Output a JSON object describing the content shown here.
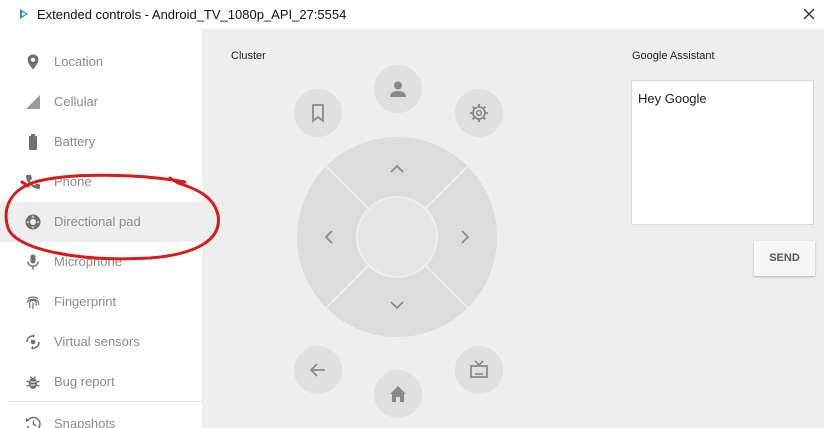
{
  "window": {
    "title": "Extended controls - Android_TV_1080p_API_27:5554"
  },
  "sidebar": {
    "items": [
      {
        "label": "Location",
        "icon": "location-pin-icon"
      },
      {
        "label": "Cellular",
        "icon": "signal-icon"
      },
      {
        "label": "Battery",
        "icon": "battery-icon"
      },
      {
        "label": "Phone",
        "icon": "phone-icon"
      },
      {
        "label": "Directional pad",
        "icon": "dpad-icon",
        "selected": true
      },
      {
        "label": "Microphone",
        "icon": "microphone-icon"
      },
      {
        "label": "Fingerprint",
        "icon": "fingerprint-icon"
      },
      {
        "label": "Virtual sensors",
        "icon": "rotate-icon"
      },
      {
        "label": "Bug report",
        "icon": "bug-icon"
      },
      {
        "label": "Snapshots",
        "icon": "history-icon"
      }
    ]
  },
  "cluster": {
    "label": "Cluster"
  },
  "assistant": {
    "label": "Google Assistant",
    "text": "Hey Google",
    "send_label": "SEND"
  },
  "colors": {
    "panel_bg": "#eeeeee",
    "button_bg": "#e0e0e0",
    "icon_gray": "#8a8a8a",
    "dpad_outer": "#dcdcdc",
    "annotation_red": "#d81b1b"
  }
}
